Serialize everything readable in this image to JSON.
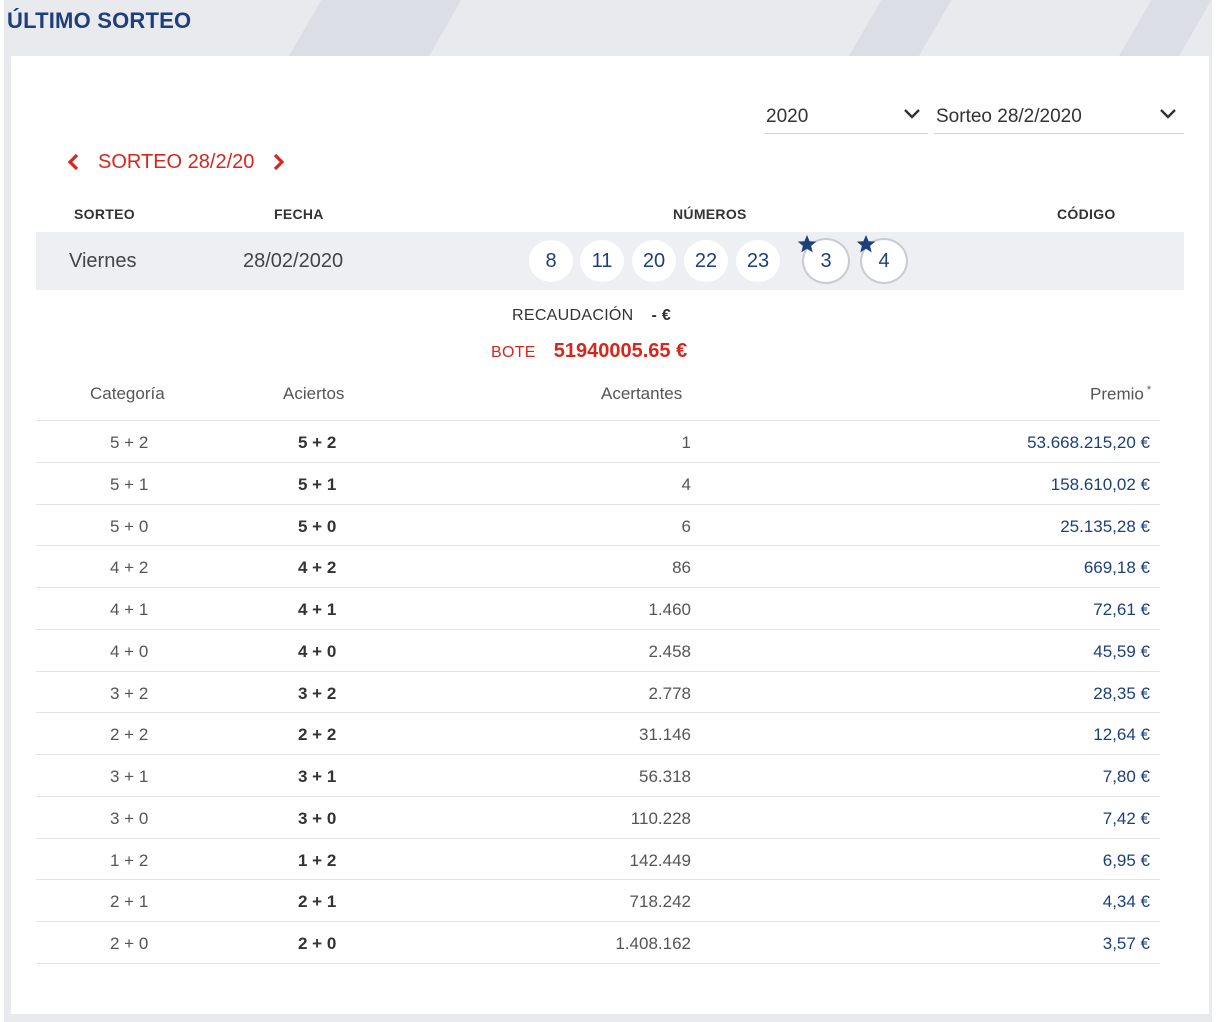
{
  "page": {
    "title": "ÚLTIMO SORTEO"
  },
  "filters": {
    "year": "2020",
    "draw": "Sorteo 28/2/2020"
  },
  "nav": {
    "title": "SORTEO 28/2/20"
  },
  "draw_header": {
    "sorteo": "SORTEO",
    "fecha": "FECHA",
    "numeros": "NÚMEROS",
    "codigo": "CÓDIGO"
  },
  "draw": {
    "day": "Viernes",
    "date": "28/02/2020",
    "numbers": [
      "8",
      "11",
      "20",
      "22",
      "23"
    ],
    "stars": [
      "3",
      "4"
    ],
    "code": ""
  },
  "recaudacion": {
    "label": "RECAUDACIÓN",
    "value": "- €"
  },
  "bote": {
    "label": "BOTE",
    "value": "51940005.65 €"
  },
  "table": {
    "headers": {
      "categoria": "Categoría",
      "aciertos": "Aciertos",
      "acertantes": "Acertantes",
      "premio": "Premio",
      "premio_note": "*"
    },
    "rows": [
      {
        "categoria": "5 + 2",
        "aciertos": "5 + 2",
        "acertantes": "1",
        "premio": "53.668.215,20 €"
      },
      {
        "categoria": "5 + 1",
        "aciertos": "5 + 1",
        "acertantes": "4",
        "premio": "158.610,02 €"
      },
      {
        "categoria": "5 + 0",
        "aciertos": "5 + 0",
        "acertantes": "6",
        "premio": "25.135,28 €"
      },
      {
        "categoria": "4 + 2",
        "aciertos": "4 + 2",
        "acertantes": "86",
        "premio": "669,18 €"
      },
      {
        "categoria": "4 + 1",
        "aciertos": "4 + 1",
        "acertantes": "1.460",
        "premio": "72,61 €"
      },
      {
        "categoria": "4 + 0",
        "aciertos": "4 + 0",
        "acertantes": "2.458",
        "premio": "45,59 €"
      },
      {
        "categoria": "3 + 2",
        "aciertos": "3 + 2",
        "acertantes": "2.778",
        "premio": "28,35 €"
      },
      {
        "categoria": "2 + 2",
        "aciertos": "2 + 2",
        "acertantes": "31.146",
        "premio": "12,64 €"
      },
      {
        "categoria": "3 + 1",
        "aciertos": "3 + 1",
        "acertantes": "56.318",
        "premio": "7,80 €"
      },
      {
        "categoria": "3 + 0",
        "aciertos": "3 + 0",
        "acertantes": "110.228",
        "premio": "7,42 €"
      },
      {
        "categoria": "1 + 2",
        "aciertos": "1 + 2",
        "acertantes": "142.449",
        "premio": "6,95 €"
      },
      {
        "categoria": "2 + 1",
        "aciertos": "2 + 1",
        "acertantes": "718.242",
        "premio": "4,34 €"
      },
      {
        "categoria": "2 + 0",
        "aciertos": "2 + 0",
        "acertantes": "1.408.162",
        "premio": "3,57 €"
      }
    ]
  },
  "colors": {
    "brand_blue": "#1d3f7c",
    "accent_red": "#d9261c",
    "row_bg": "#eeeff3"
  },
  "icons": {
    "prev": "chevron-left-icon",
    "next": "chevron-right-icon",
    "dropdown": "chevron-down-icon",
    "star": "star-icon"
  }
}
